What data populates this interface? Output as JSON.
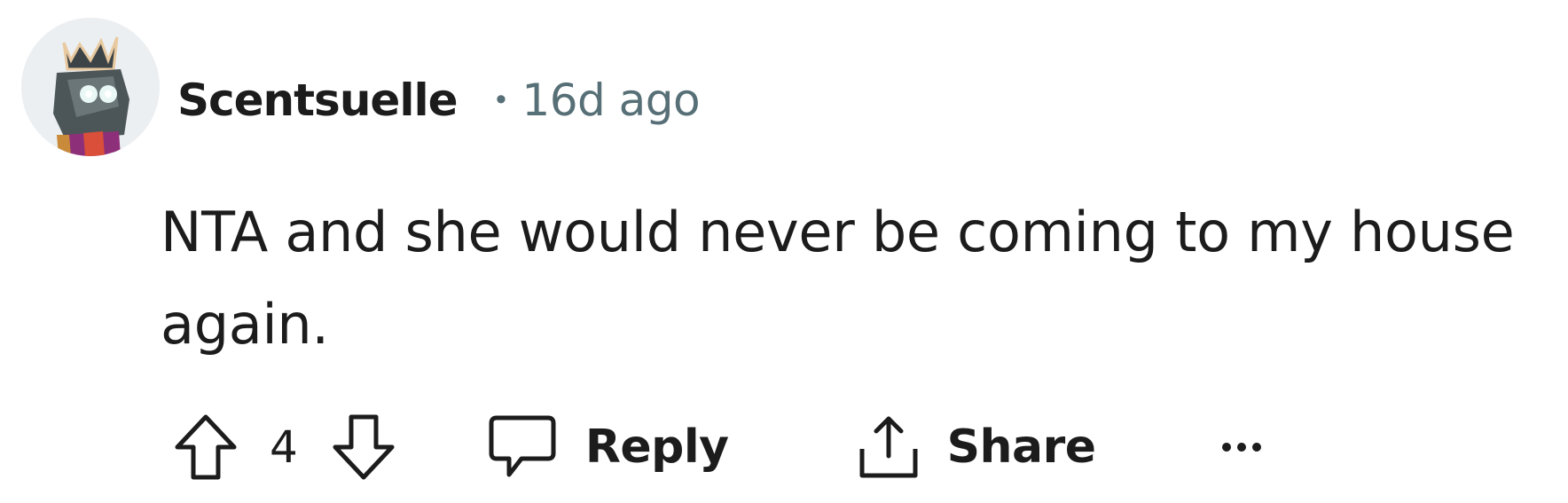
{
  "comment": {
    "author": "Scentsuelle",
    "separator": "•",
    "timestamp": "16d ago",
    "text": "NTA and she would never be coming to my house again.",
    "score": "4",
    "actions": {
      "reply_label": "Reply",
      "share_label": "Share"
    },
    "icons": {
      "avatar": "avatar",
      "upvote": "arrow-up-icon",
      "downvote": "arrow-down-icon",
      "reply": "speech-bubble-icon",
      "share": "share-icon",
      "more": "more-options-icon"
    }
  },
  "colors": {
    "text": "#1c1c1c",
    "meta": "#576f76",
    "background": "#ffffff"
  }
}
